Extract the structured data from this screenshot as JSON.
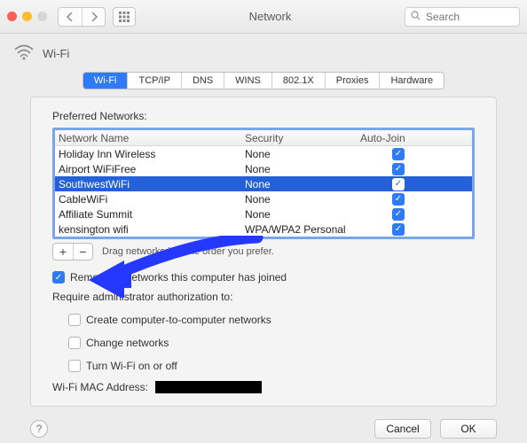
{
  "window": {
    "title": "Network",
    "search_placeholder": "Search"
  },
  "header": {
    "section": "Wi-Fi"
  },
  "tabs": [
    "Wi-Fi",
    "TCP/IP",
    "DNS",
    "WINS",
    "802.1X",
    "Proxies",
    "Hardware"
  ],
  "panel": {
    "preferred_label": "Preferred Networks:",
    "columns": {
      "name": "Network Name",
      "security": "Security",
      "autojoin": "Auto-Join"
    },
    "networks": [
      {
        "name": "Holiday Inn Wireless",
        "security": "None",
        "autojoin": true,
        "selected": false
      },
      {
        "name": "Airport WiFiFree",
        "security": "None",
        "autojoin": true,
        "selected": false
      },
      {
        "name": "SouthwestWiFi",
        "security": "None",
        "autojoin": true,
        "selected": true
      },
      {
        "name": "CableWiFi",
        "security": "None",
        "autojoin": true,
        "selected": false
      },
      {
        "name": "Affiliate Summit",
        "security": "None",
        "autojoin": true,
        "selected": false
      },
      {
        "name": "kensington wifi",
        "security": "WPA/WPA2 Personal",
        "autojoin": true,
        "selected": false
      }
    ],
    "drag_hint": "Drag networks into the order you prefer.",
    "remember_label": "Remember networks this computer has joined",
    "remember_checked": true,
    "admin_label": "Require administrator authorization to:",
    "admin_opts": [
      {
        "label": "Create computer-to-computer networks",
        "checked": false
      },
      {
        "label": "Change networks",
        "checked": false
      },
      {
        "label": "Turn Wi-Fi on or off",
        "checked": false
      }
    ],
    "mac_label": "Wi-Fi MAC Address:"
  },
  "footer": {
    "cancel": "Cancel",
    "ok": "OK"
  }
}
